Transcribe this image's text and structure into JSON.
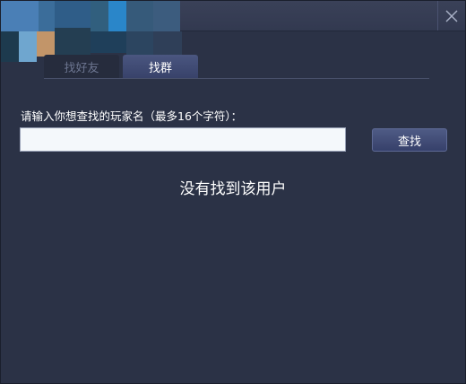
{
  "window": {
    "close_icon": "close-icon"
  },
  "tabs": [
    {
      "label": "找好友",
      "active": false
    },
    {
      "label": "找群",
      "active": true
    }
  ],
  "search": {
    "prompt": "请输入你想查找的玩家名（最多16个字符）：",
    "input_value": "",
    "input_placeholder": "",
    "button_label": "查找"
  },
  "result": {
    "message": "没有找到该用户"
  },
  "colors": {
    "background": "#2b3246",
    "titlebar": "#363d54",
    "accent_button": "#434e78",
    "input_bg": "#f4f8fb",
    "text": "#ffffff"
  }
}
